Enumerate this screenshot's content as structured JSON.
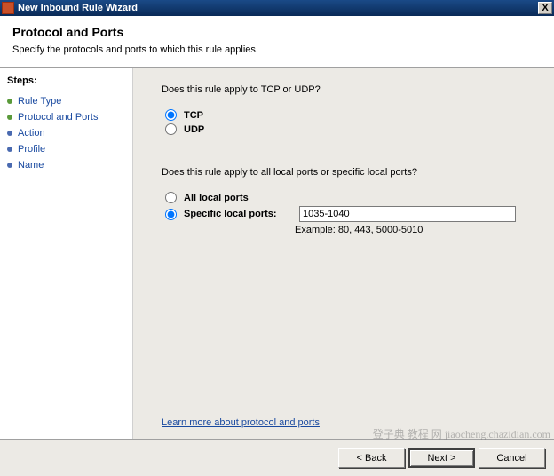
{
  "titlebar": {
    "title": "New Inbound Rule Wizard",
    "close": "X"
  },
  "header": {
    "title": "Protocol and Ports",
    "subtitle": "Specify the protocols and ports to which this rule applies."
  },
  "sidebar": {
    "label": "Steps:",
    "items": [
      {
        "label": "Rule Type",
        "state": "done"
      },
      {
        "label": "Protocol and Ports",
        "state": "current"
      },
      {
        "label": "Action",
        "state": "pending"
      },
      {
        "label": "Profile",
        "state": "pending"
      },
      {
        "label": "Name",
        "state": "pending"
      }
    ]
  },
  "main": {
    "q1": "Does this rule apply to TCP or UDP?",
    "tcp": "TCP",
    "udp": "UDP",
    "q2": "Does this rule apply to all local ports or specific local ports?",
    "all_ports": "All local ports",
    "specific_ports": "Specific local ports:",
    "ports_value": "1035-1040",
    "example": "Example: 80, 443, 5000-5010",
    "learn": "Learn more about protocol and ports"
  },
  "footer": {
    "back": "< Back",
    "next": "Next >",
    "cancel": "Cancel"
  },
  "watermark": "登子典 教程 网\njiaocheng.chazidian.com"
}
